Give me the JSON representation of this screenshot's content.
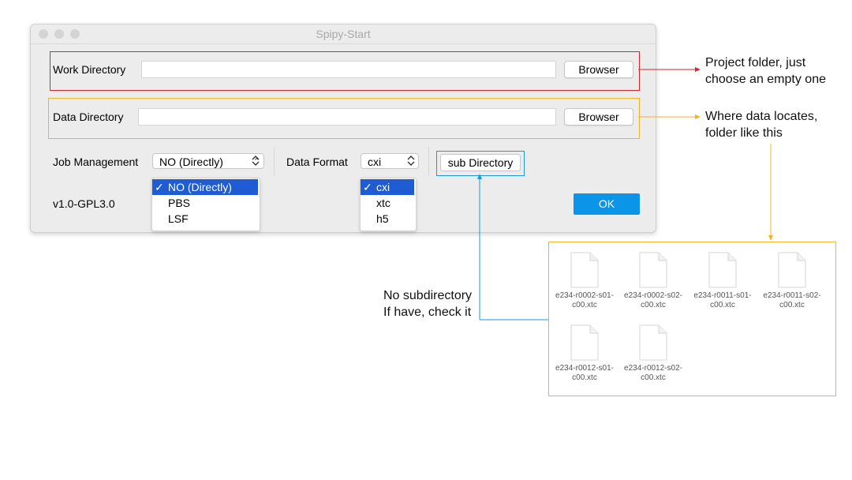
{
  "window": {
    "title": "Spipy-Start",
    "work_label": "Work Directory",
    "work_value": "",
    "work_browse": "Browser",
    "data_label": "Data Directory",
    "data_value": "",
    "data_browse": "Browser",
    "job_label": "Job Management",
    "job_selected": "NO (Directly)",
    "job_options": [
      "NO (Directly)",
      "PBS",
      "LSF"
    ],
    "format_label": "Data Format",
    "format_selected": "cxi",
    "format_options": [
      "cxi",
      "xtc",
      "h5"
    ],
    "sub_button": "sub Directory",
    "version": "v1.0-GPL3.0",
    "ok": "OK"
  },
  "annotations": {
    "project": [
      "Project folder, just",
      "choose an empty one"
    ],
    "data": [
      "Where data locates,",
      "folder like this"
    ],
    "subdir": [
      "No subdirectory",
      "If have, check it"
    ]
  },
  "files": [
    [
      "e234-r0002-s01-",
      "c00.xtc"
    ],
    [
      "e234-r0002-s02-",
      "c00.xtc"
    ],
    [
      "e234-r0011-s01-",
      "c00.xtc"
    ],
    [
      "e234-r0011-s02-",
      "c00.xtc"
    ],
    [
      "e234-r0012-s01-",
      "c00.xtc"
    ],
    [
      "e234-r0012-s02-",
      "c00.xtc"
    ]
  ],
  "colors": {
    "red": "#d3262b",
    "orange": "#f0b429",
    "blue": "#1a9ad7",
    "ok": "#0a95e9",
    "menu_selected": "#1f5bd3"
  }
}
